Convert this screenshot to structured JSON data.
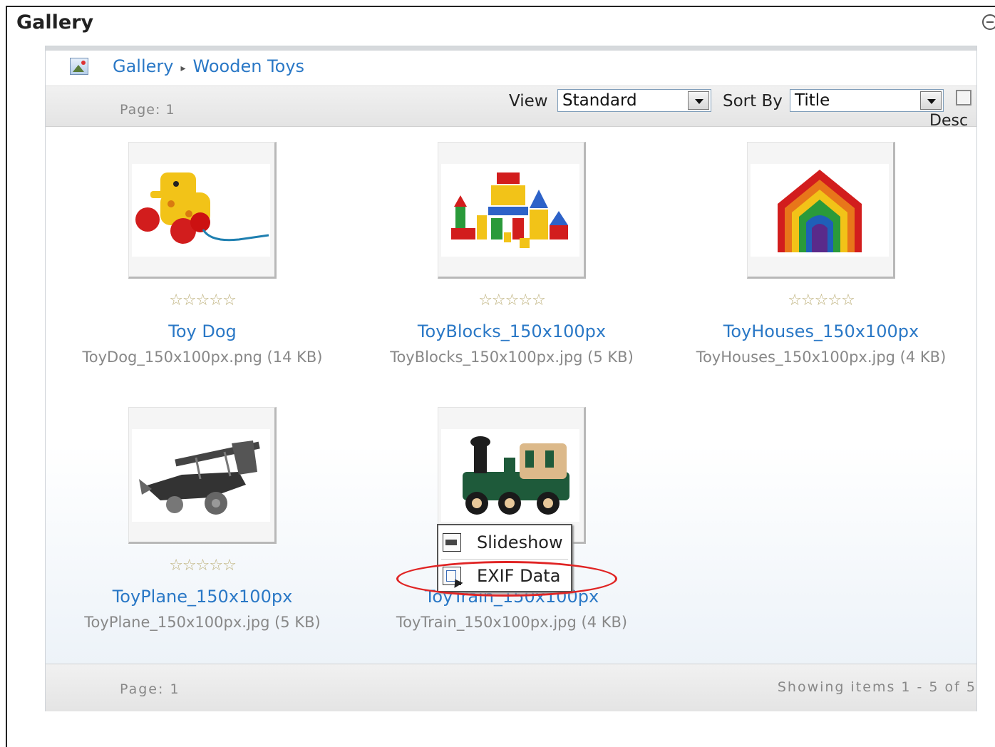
{
  "module": {
    "title": "Gallery"
  },
  "breadcrumb": {
    "root": "Gallery",
    "current": "Wooden Toys"
  },
  "toolbar": {
    "page_label": "Page: 1",
    "view_label": "View",
    "view_value": "Standard",
    "sort_label": "Sort By",
    "sort_value": "Title",
    "desc_label": "Desc",
    "desc_checked": false
  },
  "items": [
    {
      "title": "Toy Dog",
      "file": "ToyDog_150x100px.png (14 KB)",
      "rating": "☆☆☆☆☆"
    },
    {
      "title": "ToyBlocks_150x100px",
      "file": "ToyBlocks_150x100px.jpg (5 KB)",
      "rating": "☆☆☆☆☆"
    },
    {
      "title": "ToyHouses_150x100px",
      "file": "ToyHouses_150x100px.jpg (4 KB)",
      "rating": "☆☆☆☆☆"
    },
    {
      "title": "ToyPlane_150x100px",
      "file": "ToyPlane_150x100px.jpg (5 KB)",
      "rating": "☆☆☆☆☆"
    },
    {
      "title": "ToyTrain_150x100px",
      "file": "ToyTrain_150x100px.jpg (4 KB)",
      "rating": ""
    }
  ],
  "context_menu": {
    "items": [
      "Slideshow",
      "EXIF Data"
    ]
  },
  "footer": {
    "page_label": "Page: 1",
    "showing": "Showing items 1 - 5 of 5"
  },
  "colors": {
    "link": "#2a78c6",
    "muted": "#888888",
    "annotation": "#e02424"
  }
}
